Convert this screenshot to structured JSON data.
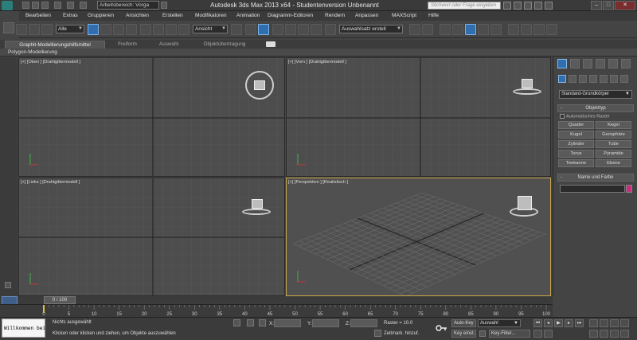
{
  "title_bar": {
    "workspace": "Arbeitsbereich: Vorga",
    "app_title": "Autodesk 3ds Max  2013 x64  - Studentenversion    Unbenannt",
    "help_search_placeholder": "Stichwort oder Frage eingeben"
  },
  "menu": [
    "Bearbeiten",
    "Extras",
    "Gruppieren",
    "Ansichten",
    "Erstellen",
    "Modifikatoren",
    "Animation",
    "Diagramm-Editoren",
    "Rendern",
    "Anpassen",
    "MAXScript",
    "Hilfe"
  ],
  "toolbar": {
    "filter_value": "Alle",
    "coord_system": "Ansicht",
    "named_selection": "Auswahlsatz erstell"
  },
  "ribbon": {
    "tabs": [
      "Graphit-Modellierungshilfsmittel",
      "Freiform",
      "Auswahl",
      "Objektübertragung"
    ],
    "panel_label": "Polygon-Modellierung"
  },
  "viewports": {
    "top": "[+] [Oben ] [Drahtgittermodell ]",
    "front": "[+] [Vorn ] [Drahtgittermodell ]",
    "left": "[+] [Links ] [Drahtgittermodell ]",
    "perspective": "[+] [Perspektive ] [Realistisch ]"
  },
  "command_panel": {
    "category": "Standard-Grundkörper",
    "object_type_header": "Objekttyp",
    "autogrid_label": "Automatisches Raster",
    "objects": [
      "Quader",
      "Kegel",
      "Kugel",
      "Geosphäre",
      "Zylinder",
      "Tube",
      "Torus",
      "Pyramide",
      "Teekanne",
      "Ebene"
    ],
    "name_color_header": "Name und Farbe",
    "swatch_color": "#c4307a"
  },
  "timeline": {
    "frame_counter": "0 / 100",
    "ticks": [
      "0",
      "5",
      "10",
      "15",
      "20",
      "25",
      "30",
      "35",
      "40",
      "45",
      "50",
      "55",
      "60",
      "65",
      "70",
      "75",
      "80",
      "85",
      "90",
      "95",
      "100"
    ]
  },
  "status": {
    "welcome": "Willkommen bei",
    "selection": "Nichts ausgewählt",
    "prompt": "Klicken oder klicken und ziehen, um Objekte auszuwählen",
    "x_label": "X:",
    "y_label": "Y:",
    "z_label": "Z:",
    "grid": "Raster = 10.0",
    "add_time_tag": "Zeitmark. hinzuf.",
    "auto_key": "Auto-Key",
    "set_key": "Key einst.",
    "auto_key_dropdown": "Auswahl",
    "key_filters": "Key-Filter..."
  },
  "colors": {
    "accent": "#2f6fb0",
    "active_viewport": "#c8a84a"
  }
}
